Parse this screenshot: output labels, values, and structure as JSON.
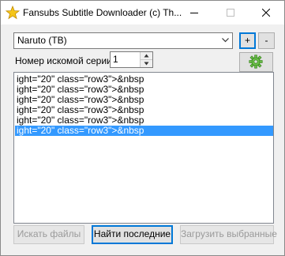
{
  "window": {
    "title": "Fansubs Subtitle Downloader (c) Th..."
  },
  "series_select": {
    "value": "Naruto (TB)"
  },
  "controls": {
    "add_label": "+",
    "remove_label": "-",
    "episode_label": "Номер искомой серии",
    "episode_value": "1"
  },
  "results": {
    "items": [
      "ight=\"20\" class=\"row3\">&nbsp",
      "ight=\"20\" class=\"row3\">&nbsp",
      "ight=\"20\" class=\"row3\">&nbsp",
      "ight=\"20\" class=\"row3\">&nbsp",
      "ight=\"20\" class=\"row3\">&nbsp",
      "ight=\"20\" class=\"row3\">&nbsp"
    ],
    "selected_index": 5
  },
  "buttons": {
    "search_files": "Искать файлы",
    "find_latest": "Найти последние",
    "download_selected": "Загрузить выбранные"
  },
  "colors": {
    "selection": "#3399ff",
    "focus_border": "#0078d7",
    "gear_green": "#6cc04a"
  },
  "icons": {
    "app": "star-icon",
    "settings": "gear-icon"
  }
}
